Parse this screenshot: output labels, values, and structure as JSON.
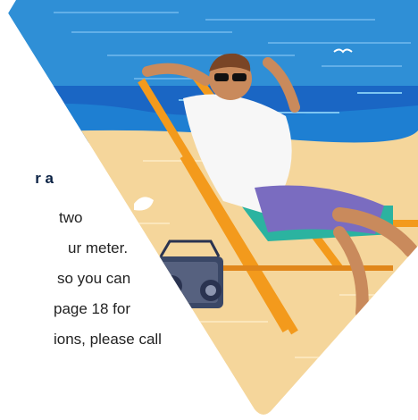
{
  "copy": {
    "heading_fragment": "r a",
    "line1": "two",
    "line2": "ur meter.",
    "line3": "so you can",
    "line4": "page 18 for",
    "line5": "ions, please call"
  },
  "colors": {
    "sky": "#2f8fd6",
    "sea": "#1a66c4",
    "sand": "#f5d69b",
    "chair_frame": "#f39a1c",
    "heading_text": "#0b2244",
    "body_text": "#222222"
  }
}
